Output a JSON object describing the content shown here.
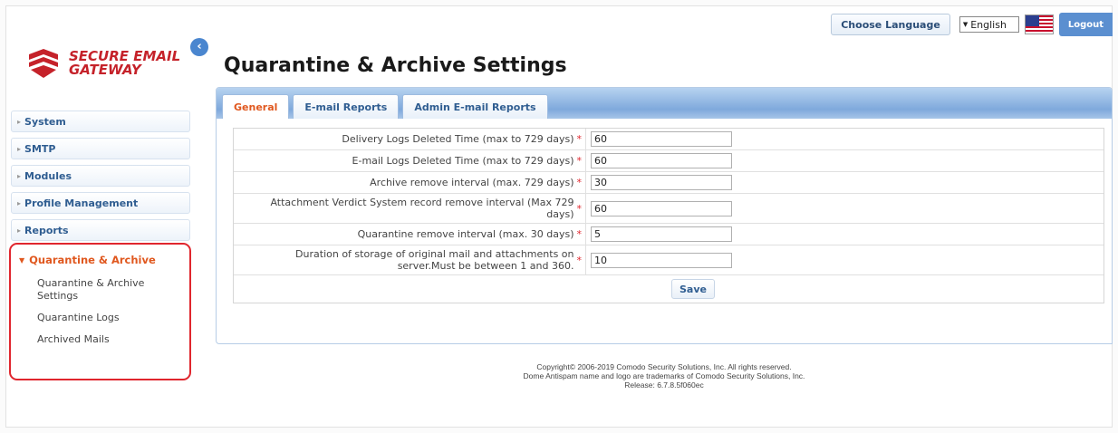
{
  "header": {
    "choose_language": "Choose Language",
    "language_selected": "English",
    "logout": "Logout"
  },
  "logo": {
    "line1": "SECURE EMAIL",
    "line2": "GATEWAY"
  },
  "page_title": "Quarantine & Archive Settings",
  "sidebar": {
    "items": [
      {
        "label": "System"
      },
      {
        "label": "SMTP"
      },
      {
        "label": "Modules"
      },
      {
        "label": "Profile Management"
      },
      {
        "label": "Reports"
      }
    ],
    "active_section": {
      "label": "Quarantine & Archive",
      "children": [
        {
          "label": "Quarantine & Archive Settings"
        },
        {
          "label": "Quarantine Logs"
        },
        {
          "label": "Archived Mails"
        }
      ]
    }
  },
  "tabs": [
    {
      "label": "General",
      "active": true
    },
    {
      "label": "E-mail Reports",
      "active": false
    },
    {
      "label": "Admin E-mail Reports",
      "active": false
    }
  ],
  "form": {
    "rows": [
      {
        "label": "Delivery Logs Deleted Time (max to 729 days)",
        "value": "60"
      },
      {
        "label": "E-mail Logs Deleted Time (max to 729 days)",
        "value": "60"
      },
      {
        "label": "Archive remove interval (max. 729 days)",
        "value": "30"
      },
      {
        "label": "Attachment Verdict System record remove interval (Max 729 days)",
        "value": "60"
      },
      {
        "label": "Quarantine remove interval (max. 30 days)",
        "value": "5"
      },
      {
        "label": "Duration of storage of original mail and attachments on server.Must be between 1 and 360.",
        "value": "10"
      }
    ],
    "required_mark": "*",
    "save_label": "Save"
  },
  "footer": {
    "line1": "Copyright© 2006-2019 Comodo Security Solutions, Inc. All rights reserved.",
    "line2": "Dome Antispam name and logo are trademarks of Comodo Security Solutions, Inc.",
    "line3": "Release: 6.7.8.5f060ec"
  },
  "colors": {
    "brand_red": "#c5222a",
    "active_orange": "#e0581f",
    "nav_blue": "#2f5d91",
    "highlight_border": "#e0262e"
  }
}
